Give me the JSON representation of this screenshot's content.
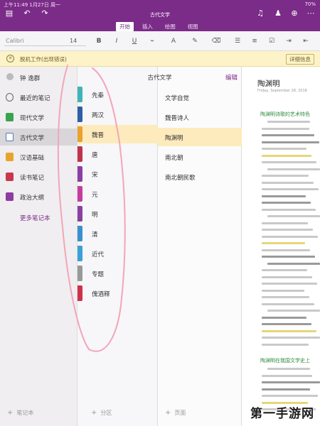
{
  "status": {
    "time_date": "上午11:49  1月27日 周一",
    "battery": "70%"
  },
  "header": {
    "doc_title": "古代文学"
  },
  "ribbon": {
    "tabs": [
      "开始",
      "插入",
      "绘图",
      "视图"
    ]
  },
  "toolbar": {
    "font": "Calibri",
    "size": "14",
    "bold": "B",
    "italic": "I",
    "underline": "U"
  },
  "notice": {
    "message": "脱机工作(出现错误)",
    "detail": "详细信息"
  },
  "notebooks": {
    "user": "钟 逸群",
    "items": [
      {
        "label": "最近的笔记",
        "color": "#777777"
      },
      {
        "label": "现代文学",
        "color": "#3aa34f"
      },
      {
        "label": "古代文学",
        "color": "#4b78b8"
      },
      {
        "label": "汉语基础",
        "color": "#e8a42a"
      },
      {
        "label": "读书笔记",
        "color": "#c8384d"
      },
      {
        "label": "政治大纲",
        "color": "#8c3da0"
      }
    ],
    "more": "更多笔记本",
    "add": "笔记本"
  },
  "sections": {
    "header_title": "古代文学",
    "edit": "编辑",
    "items": [
      {
        "label": "先秦",
        "color": "#3fb4b8"
      },
      {
        "label": "两汉",
        "color": "#2e5fa6"
      },
      {
        "label": "魏晋",
        "color": "#e9a12f"
      },
      {
        "label": "唐",
        "color": "#c0334f"
      },
      {
        "label": "宋",
        "color": "#8b3fa2"
      },
      {
        "label": "元",
        "color": "#c53c9f"
      },
      {
        "label": "明",
        "color": "#8b3fa2"
      },
      {
        "label": "清",
        "color": "#3a8fd1"
      },
      {
        "label": "近代",
        "color": "#3aa0d6"
      },
      {
        "label": "专题",
        "color": "#999999"
      },
      {
        "label": "傀酒释",
        "color": "#d0314a"
      }
    ],
    "add": "分区"
  },
  "pages": {
    "items": [
      "文学自觉",
      "魏晋诗人",
      "陶渊明",
      "南北朝",
      "南北朝民歌"
    ],
    "add": "页面"
  },
  "document": {
    "title": "陶渊明",
    "date": "Friday, September 28, 2018",
    "heading1": "陶渊明诗歌的艺术特色",
    "heading2": "陶渊明在我国文学史上"
  },
  "watermark": "第一手游网",
  "colors": {
    "brand": "#7b2b88",
    "highlight": "#fdebbd",
    "annotation": "#f2a6b8"
  }
}
